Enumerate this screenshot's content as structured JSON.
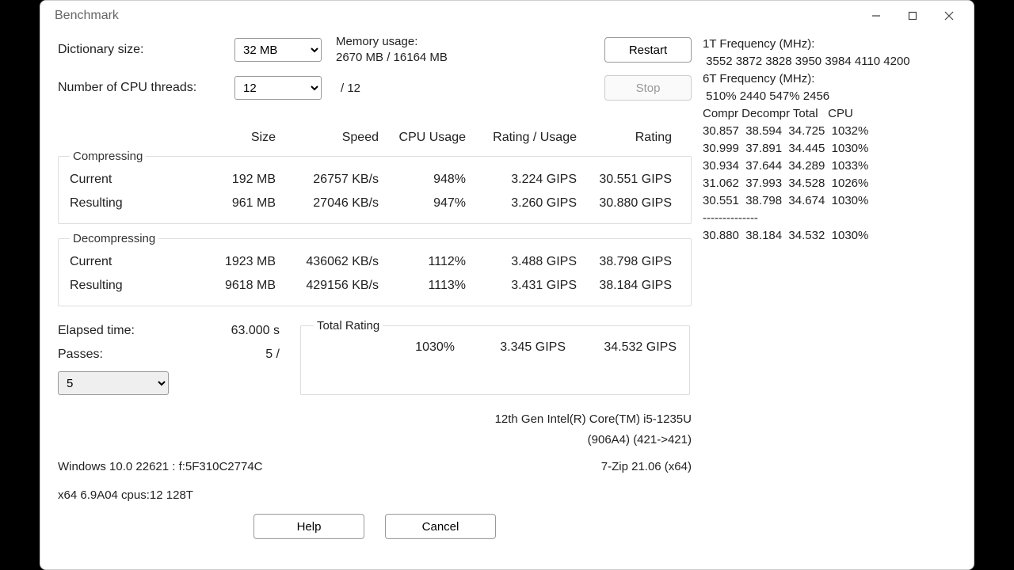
{
  "window": {
    "title": "Benchmark"
  },
  "controls": {
    "dict_label": "Dictionary size:",
    "dict_value": "32 MB",
    "threads_label": "Number of CPU threads:",
    "threads_value": "12",
    "threads_max": "/ 12",
    "mem_label": "Memory usage:",
    "mem_value": "2670 MB / 16164 MB",
    "restart": "Restart",
    "stop": "Stop"
  },
  "headers": {
    "size": "Size",
    "speed": "Speed",
    "cpu": "CPU Usage",
    "ru": "Rating / Usage",
    "rating": "Rating"
  },
  "compressing": {
    "legend": "Compressing",
    "rows": [
      {
        "label": "Current",
        "size": "192 MB",
        "speed": "26757 KB/s",
        "cpu": "948%",
        "ru": "3.224 GIPS",
        "rating": "30.551 GIPS"
      },
      {
        "label": "Resulting",
        "size": "961 MB",
        "speed": "27046 KB/s",
        "cpu": "947%",
        "ru": "3.260 GIPS",
        "rating": "30.880 GIPS"
      }
    ]
  },
  "decompressing": {
    "legend": "Decompressing",
    "rows": [
      {
        "label": "Current",
        "size": "1923 MB",
        "speed": "436062 KB/s",
        "cpu": "1112%",
        "ru": "3.488 GIPS",
        "rating": "38.798 GIPS"
      },
      {
        "label": "Resulting",
        "size": "9618 MB",
        "speed": "429156 KB/s",
        "cpu": "1113%",
        "ru": "3.431 GIPS",
        "rating": "38.184 GIPS"
      }
    ]
  },
  "elapsed": {
    "label": "Elapsed time:",
    "value": "63.000 s"
  },
  "passes": {
    "label": "Passes:",
    "value": "5 /",
    "select": "5"
  },
  "total": {
    "legend": "Total Rating",
    "cpu": "1030%",
    "ru": "3.345 GIPS",
    "rating": "34.532 GIPS"
  },
  "footer": {
    "cpu_line1": "12th Gen Intel(R) Core(TM) i5-1235U",
    "cpu_line2": "(906A4) (421->421)",
    "os": "Windows 10.0 22621 : f:5F310C2774C",
    "app": "7-Zip 21.06 (x64)",
    "build": "x64 6.9A04 cpus:12 128T",
    "help": "Help",
    "cancel": "Cancel"
  },
  "log": "1T Frequency (MHz):\n 3552 3872 3828 3950 3984 4110 4200\n6T Frequency (MHz):\n 510% 2440 547% 2456\nCompr Decompr Total   CPU\n30.857  38.594  34.725  1032%\n30.999  37.891  34.445  1030%\n30.934  37.644  34.289  1033%\n31.062  37.993  34.528  1026%\n30.551  38.798  34.674  1030%\n--------------\n30.880  38.184  34.532  1030%"
}
